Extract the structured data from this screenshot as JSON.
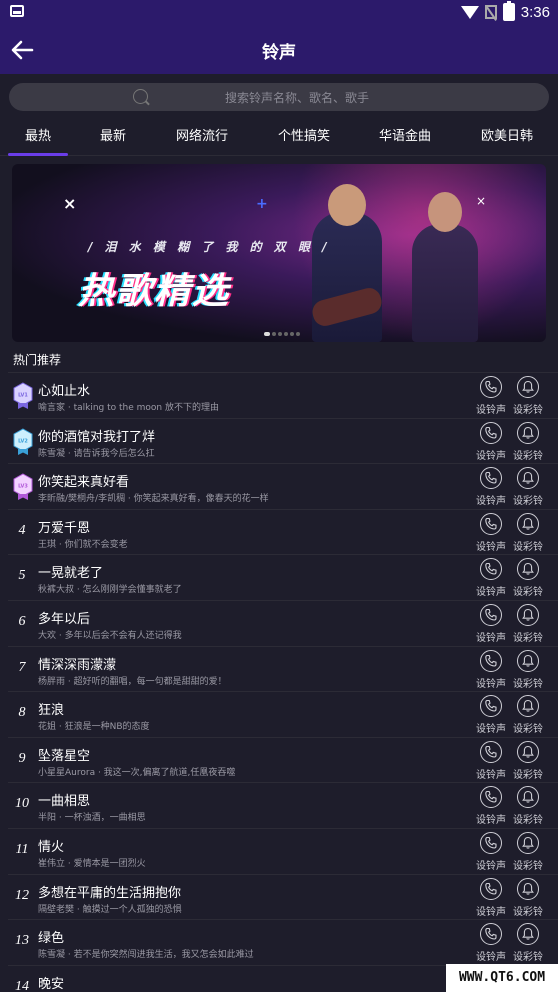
{
  "status_bar": {
    "time": "3:36"
  },
  "header": {
    "title": "铃声"
  },
  "search": {
    "placeholder": "搜索铃声名称、歌名、歌手"
  },
  "tabs": [
    {
      "label": "最热",
      "active": true
    },
    {
      "label": "最新"
    },
    {
      "label": "网络流行"
    },
    {
      "label": "个性搞笑"
    },
    {
      "label": "华语金曲"
    },
    {
      "label": "欧美日韩"
    }
  ],
  "banner": {
    "subtitle": "/ 泪 水 模 糊 了 我 的 双 眼 /",
    "title": "热歌精选",
    "slide_count": 6,
    "active_slide": 1
  },
  "section_title": "热门推荐",
  "actions": {
    "set_ringtone": "设铃声",
    "set_color_ring": "设彩铃"
  },
  "songs": [
    {
      "rank": "1",
      "badge": "LV1",
      "title": "心如止水",
      "desc": "喻言家 · talking to the moon 放不下的理由"
    },
    {
      "rank": "2",
      "badge": "LV2",
      "title": "你的酒馆对我打了烊",
      "desc": "陈雪凝 · 请告诉我今后怎么扛"
    },
    {
      "rank": "3",
      "badge": "LV3",
      "title": "你笑起来真好看",
      "desc": "李昕融/樊桐舟/李凯稠 · 你笑起来真好看，像春天的花一样"
    },
    {
      "rank": "4",
      "title": "万爱千恩",
      "desc": "王琪 · 你们就不会变老"
    },
    {
      "rank": "5",
      "title": "一晃就老了",
      "desc": "秋裤大叔 · 怎么刚刚学会懂事就老了"
    },
    {
      "rank": "6",
      "title": "多年以后",
      "desc": "大欢 · 多年以后会不会有人还记得我"
    },
    {
      "rank": "7",
      "title": "情深深雨濛濛",
      "desc": "杨胖雨 · 超好听的翻唱，每一句都是甜甜的爱！"
    },
    {
      "rank": "8",
      "title": "狂浪",
      "desc": "花姐 · 狂浪是一种NB的态度"
    },
    {
      "rank": "9",
      "title": "坠落星空",
      "desc": "小星星Aurora · 我这一次,偏离了航道,任凰夜吞噬"
    },
    {
      "rank": "10",
      "title": "一曲相思",
      "desc": "半阳 · 一杯浊酒，一曲相思"
    },
    {
      "rank": "11",
      "title": "情火",
      "desc": "崔伟立 · 爱情本是一团烈火"
    },
    {
      "rank": "12",
      "title": "多想在平庸的生活拥抱你",
      "desc": "隔壁老樊 · 触摸过一个人孤独的恐惧"
    },
    {
      "rank": "13",
      "title": "绿色",
      "desc": "陈雪凝 · 若不是你突然闯进我生活，我又怎会如此难过"
    },
    {
      "rank": "14",
      "title": "晚安",
      "desc": ""
    }
  ],
  "watermark": "WWW.QT6.COM",
  "colors": {
    "header_bg": "#2c1a6b",
    "page_bg": "#1e1d2b",
    "accent": "#6a3de8"
  }
}
